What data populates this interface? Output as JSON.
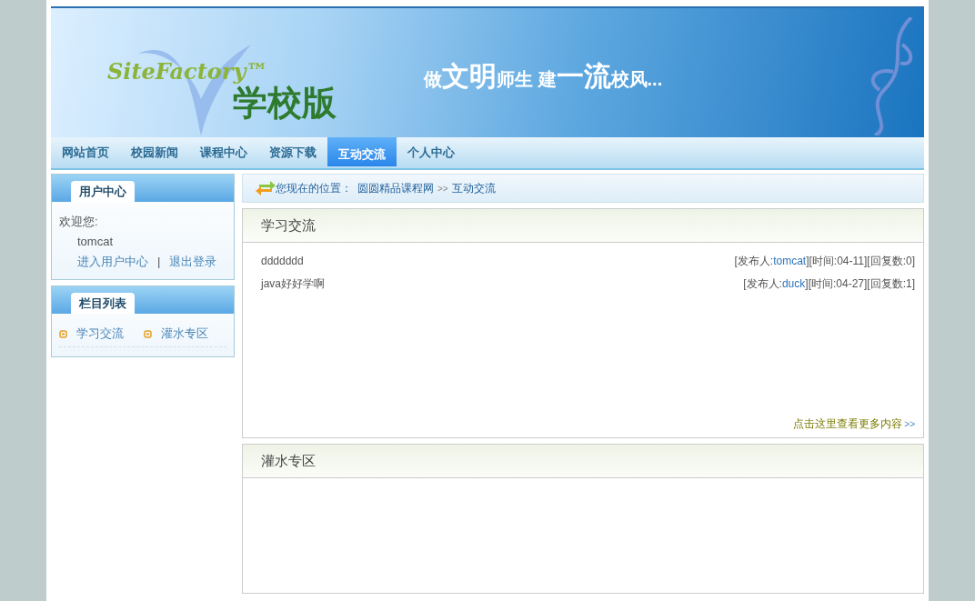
{
  "banner": {
    "logo": "SiteFactory™",
    "edition": "学校版",
    "slogan": "做**文明**师生 建**一流**校风..."
  },
  "nav": [
    {
      "label": "网站首页",
      "selected": false
    },
    {
      "label": "校园新闻",
      "selected": false
    },
    {
      "label": "课程中心",
      "selected": false
    },
    {
      "label": "资源下载",
      "selected": false
    },
    {
      "label": "互动交流",
      "selected": true
    },
    {
      "label": "个人中心",
      "selected": false
    }
  ],
  "user_panel": {
    "title": "用户中心",
    "welcome": "欢迎您:",
    "username": "tomcat",
    "links": [
      "进入用户中心",
      "退出登录"
    ],
    "separator": "|"
  },
  "column_panel": {
    "title": "栏目列表",
    "items": [
      "学习交流",
      "灌水专区"
    ]
  },
  "breadcrumb": {
    "label": "您现在的位置：",
    "path": [
      "圆圆精品课程网",
      "互动交流"
    ],
    "separator": ">>"
  },
  "sections": [
    {
      "title": "学习交流",
      "posts": [
        {
          "title": "ddddddd",
          "author_label": "[发布人:",
          "author": "tomcat",
          "details": "][时间:04-11][回复数:0]"
        },
        {
          "title": "java好好学啊",
          "author_label": "[发布人:",
          "author": "duck",
          "details": "][时间:04-27][回复数:1]"
        }
      ],
      "more": "点击这里查看更多内容",
      "more_arrow": ">>"
    },
    {
      "title": "灌水专区"
    }
  ]
}
